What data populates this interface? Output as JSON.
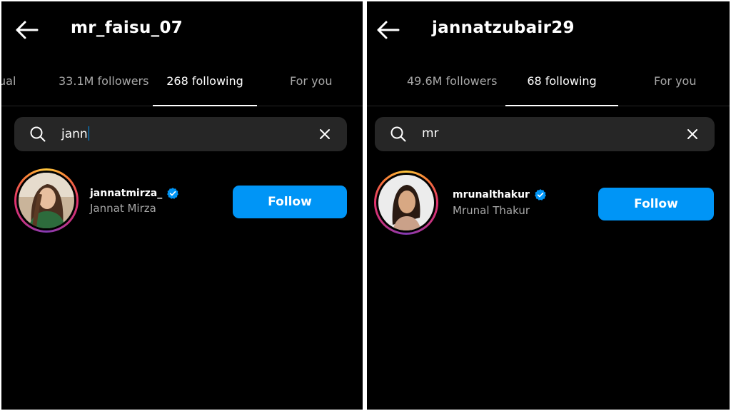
{
  "left": {
    "username": "mr_faisu_07",
    "tabs": [
      {
        "label": "ual"
      },
      {
        "label": "33.1M followers"
      },
      {
        "label": "268 following"
      },
      {
        "label": "For you"
      }
    ],
    "search_value": "jann",
    "result": {
      "handle": "jannatmirza_",
      "name": "Jannat Mirza",
      "button": "Follow"
    }
  },
  "right": {
    "username": "jannatzubair29",
    "tabs": [
      {
        "label": "49.6M followers"
      },
      {
        "label": "68 following"
      },
      {
        "label": "For you"
      }
    ],
    "search_value": "mr",
    "result": {
      "handle": "mrunalthakur",
      "name": "Mrunal Thakur",
      "button": "Follow"
    }
  },
  "colors": {
    "background": "#000000",
    "accent_blue": "#0095f6",
    "search_bg": "#262626",
    "muted_text": "#a8a8a8"
  },
  "icons": [
    "back-arrow-icon",
    "search-icon",
    "close-icon",
    "verified-badge-icon"
  ]
}
